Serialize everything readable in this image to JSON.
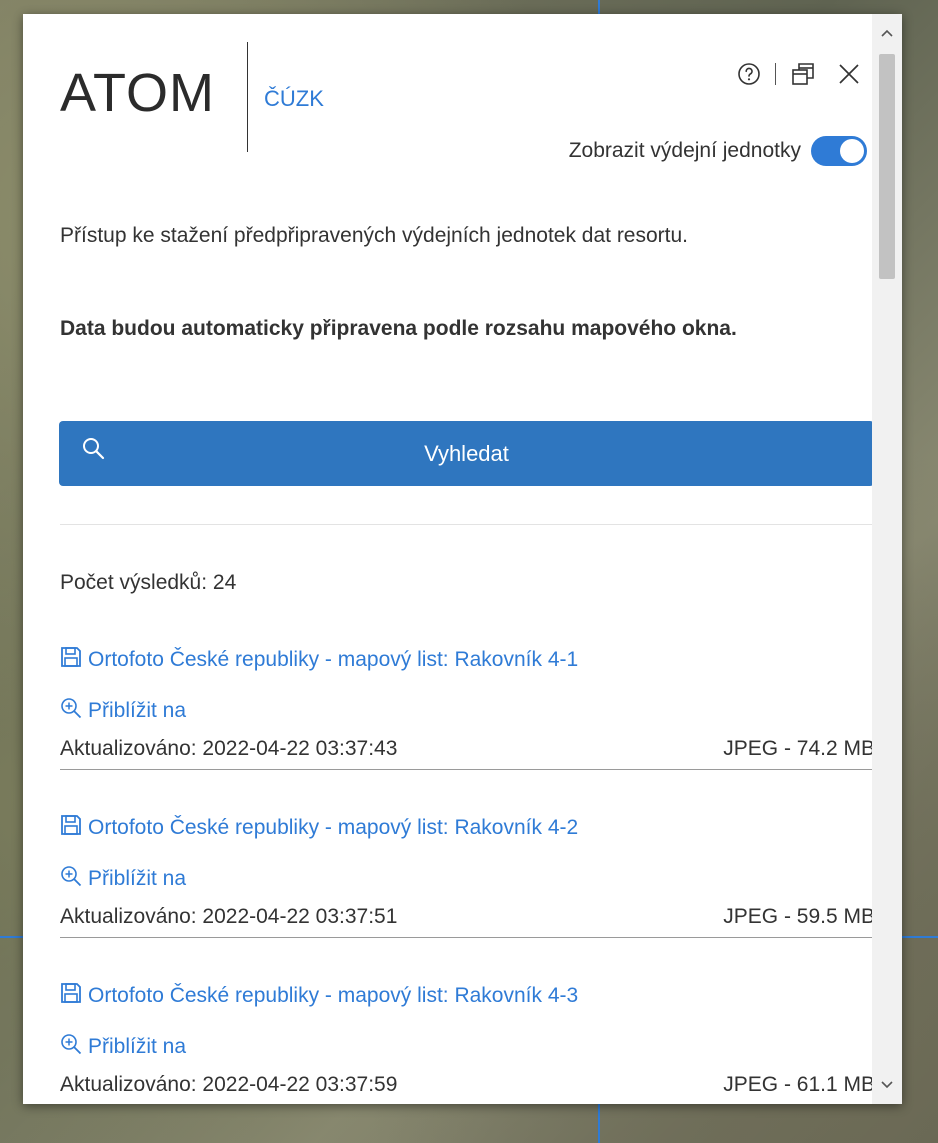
{
  "header": {
    "logo": "ATOM",
    "logo_sub": "ČÚZK",
    "icons": [
      "help-icon",
      "restore-window-icon",
      "close-icon"
    ]
  },
  "toggle": {
    "label": "Zobrazit výdejní jednotky",
    "state": "on"
  },
  "description": "Přístup ke stažení předpřipravených výdejních jednotek dat resortu.",
  "description_bold": "Data budou automaticky připravena podle rozsahu mapového okna.",
  "search_button": {
    "label": "Vyhledat"
  },
  "result_count": "Počet výsledků: 24",
  "results": [
    {
      "title": "Ortofoto České republiky - mapový list: Rakovník 4-1",
      "zoom_label": "Přiblížit na",
      "updated": "Aktualizováno: 2022-04-22 03:37:43",
      "size": "JPEG - 74.2 MB"
    },
    {
      "title": "Ortofoto České republiky - mapový list: Rakovník 4-2",
      "zoom_label": "Přiblížit na",
      "updated": "Aktualizováno: 2022-04-22 03:37:51",
      "size": "JPEG - 59.5 MB"
    },
    {
      "title": "Ortofoto České republiky - mapový list: Rakovník 4-3",
      "zoom_label": "Přiblížit na",
      "updated": "Aktualizováno: 2022-04-22 03:37:59",
      "size": "JPEG - 61.1 MB"
    }
  ],
  "colors": {
    "accent": "#2f7bd6",
    "button": "#2f76bf",
    "text": "#333333"
  }
}
